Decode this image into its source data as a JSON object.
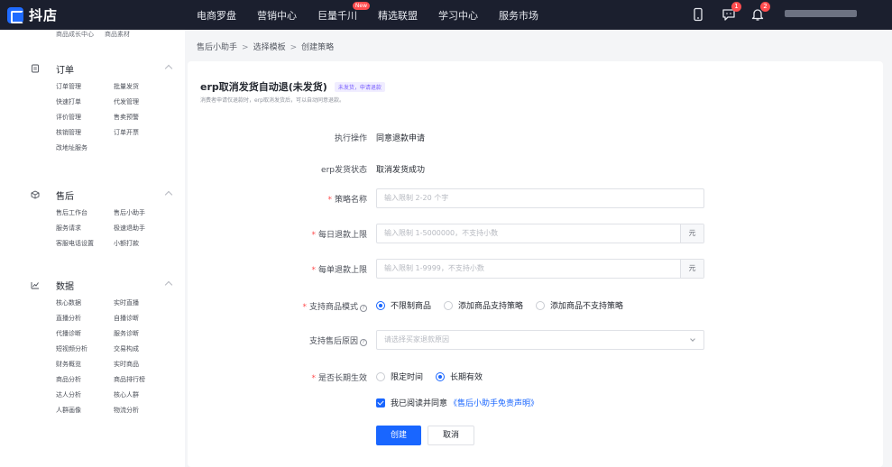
{
  "app": {
    "name": "抖店"
  },
  "topnav": [
    {
      "label": "电商罗盘"
    },
    {
      "label": "营销中心"
    },
    {
      "label": "巨量千川",
      "badge": "New"
    },
    {
      "label": "精选联盟"
    },
    {
      "label": "学习中心"
    },
    {
      "label": "服务市场"
    }
  ],
  "topbar_badges": {
    "message": "1",
    "notification": "2"
  },
  "sidebar": {
    "top_items": [
      "商品成长中心",
      "商品素材"
    ],
    "sections": [
      {
        "title": "订单",
        "icon": "order-icon",
        "items": [
          "订单管理",
          "批量发货",
          "快速打单",
          "代发管理",
          "评价管理",
          "售卖预警",
          "核销管理",
          "订单开票",
          "改地址服务"
        ]
      },
      {
        "title": "售后",
        "icon": "after-sales-icon",
        "items": [
          "售后工作台",
          "售后小助手",
          "服务请求",
          "极速退助手",
          "客服电话设置",
          "小额打款"
        ]
      },
      {
        "title": "数据",
        "icon": "data-icon",
        "items": [
          "核心数据",
          "实时直播",
          "直播分析",
          "自播诊断",
          "代播诊断",
          "服务诊断",
          "短视频分析",
          "交易构成",
          "财务概览",
          "实时商品",
          "商品分析",
          "商品排行榜",
          "达人分析",
          "核心人群",
          "人群画像",
          "物流分析"
        ]
      }
    ]
  },
  "breadcrumb": [
    "售后小助手",
    "选择模板",
    "创建策略"
  ],
  "page": {
    "title": "erp取消发货自动退(未发货)",
    "tag": "未发货，申请退款",
    "subtitle": "消费者申请仅退款时，erp取消发货后，可以自动同意退款。"
  },
  "form": {
    "action": {
      "label": "执行操作",
      "value": "同意退款申请"
    },
    "erp_status": {
      "label": "erp发货状态",
      "value": "取消发货成功"
    },
    "strategy_name": {
      "label": "策略名称",
      "placeholder": "输入限制 2-20 个字",
      "value": ""
    },
    "daily_limit": {
      "label": "每日退款上限",
      "placeholder": "输入限制 1-5000000，不支持小数",
      "unit": "元",
      "value": ""
    },
    "single_limit": {
      "label": "每单退款上限",
      "placeholder": "输入限制 1-9999，不支持小数",
      "unit": "元",
      "value": ""
    },
    "product_mode": {
      "label": "支持商品模式",
      "options": [
        "不限制商品",
        "添加商品支持策略",
        "添加商品不支持策略"
      ],
      "selected": "不限制商品"
    },
    "reason": {
      "label": "支持售后原因",
      "placeholder": "请选择买家退款原因",
      "value": ""
    },
    "long_term": {
      "label": "是否长期生效",
      "options": [
        "限定时间",
        "长期有效"
      ],
      "selected": "长期有效"
    },
    "agreement": {
      "text": "我已阅读并同意",
      "link": "《售后小助手免责声明》",
      "checked": true
    },
    "submit_label": "创建",
    "cancel_label": "取消"
  },
  "colors": {
    "primary": "#1966ff",
    "topbar": "#1b1f2e",
    "required": "#ff4d4f",
    "tag_text": "#7b61ff"
  }
}
